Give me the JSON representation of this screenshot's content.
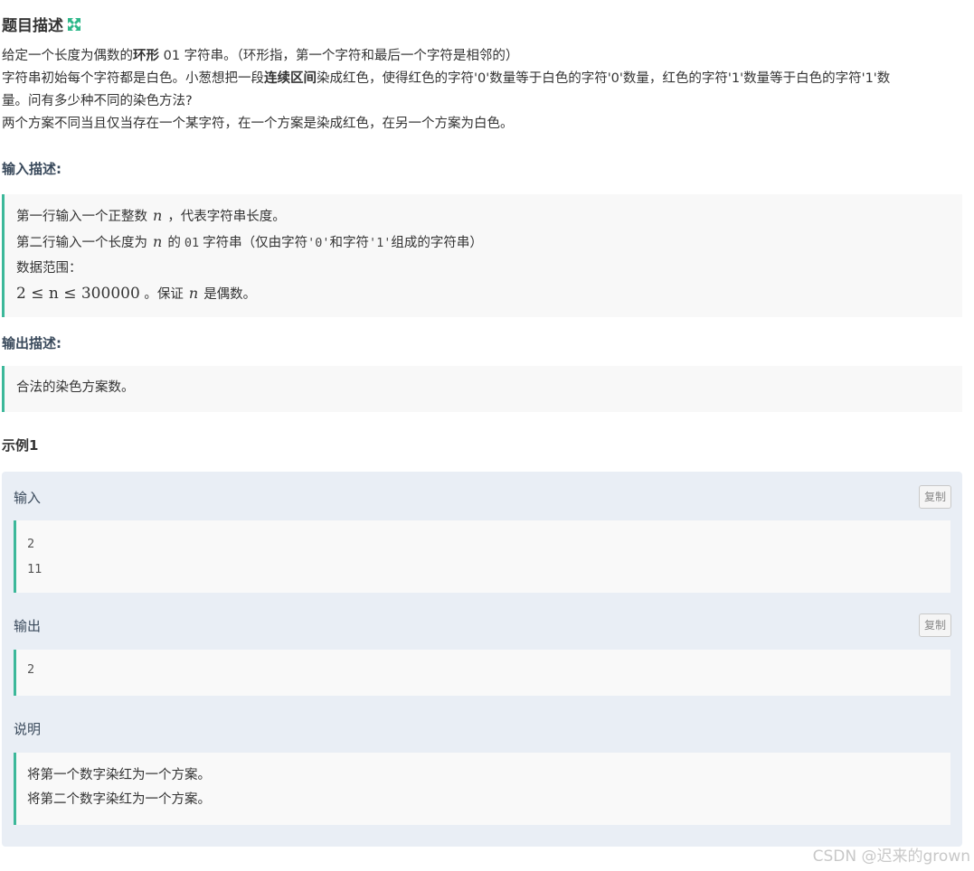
{
  "title": "题目描述",
  "description": {
    "line1_a": "给定一个长度为偶数的",
    "line1_b": "环形",
    "line1_c": " 01 字符串。（环形指，第一个字符和最后一个字符是相邻的）",
    "line2_a": "字符串初始每个字符都是白色。小葱想把一段",
    "line2_b": "连续区间",
    "line2_c": "染成红色，使得红色的字符'0'数量等于白色的字符'0'数量，红色的字符'1'数量等于白色的字符'1'数",
    "line3": "量。问有多少种不同的染色方法?",
    "line4": "两个方案不同当且仅当存在一个某字符，在一个方案是染成红色，在另一个方案为白色。"
  },
  "input_section": {
    "heading": "输入描述:",
    "l1_a": "第一行输入一个正整数",
    "var_n": "n",
    "l1_b": "，代表字符串长度。",
    "l2_a": "第二行输入一个长度为",
    "l2_b": "的",
    "l2_code": "01",
    "l2_c": "字符串（仅由字符",
    "code_0": "'0'",
    "l2_d": "和字符",
    "code_1": "'1'",
    "l2_e": "组成的字符串）",
    "l3": "数据范围：",
    "l4_math": "2 ≤ n ≤ 300000",
    "l4_a": "。保证",
    "l4_b": "是偶数。"
  },
  "output_section": {
    "heading": "输出描述:",
    "text": "合法的染色方案数。"
  },
  "example": {
    "heading": "示例1",
    "input_label": "输入",
    "input_lines": [
      "2",
      "11"
    ],
    "output_label": "输出",
    "output_lines": [
      "2"
    ],
    "copy_label": "复制",
    "note_label": "说明",
    "note_lines": [
      "将第一个数字染红为一个方案。",
      "将第二个数字染红为一个方案。"
    ]
  },
  "watermark": "CSDN @迟来的grown",
  "colors": {
    "accent": "#3cb89a",
    "example_bg": "#e9eef5"
  }
}
